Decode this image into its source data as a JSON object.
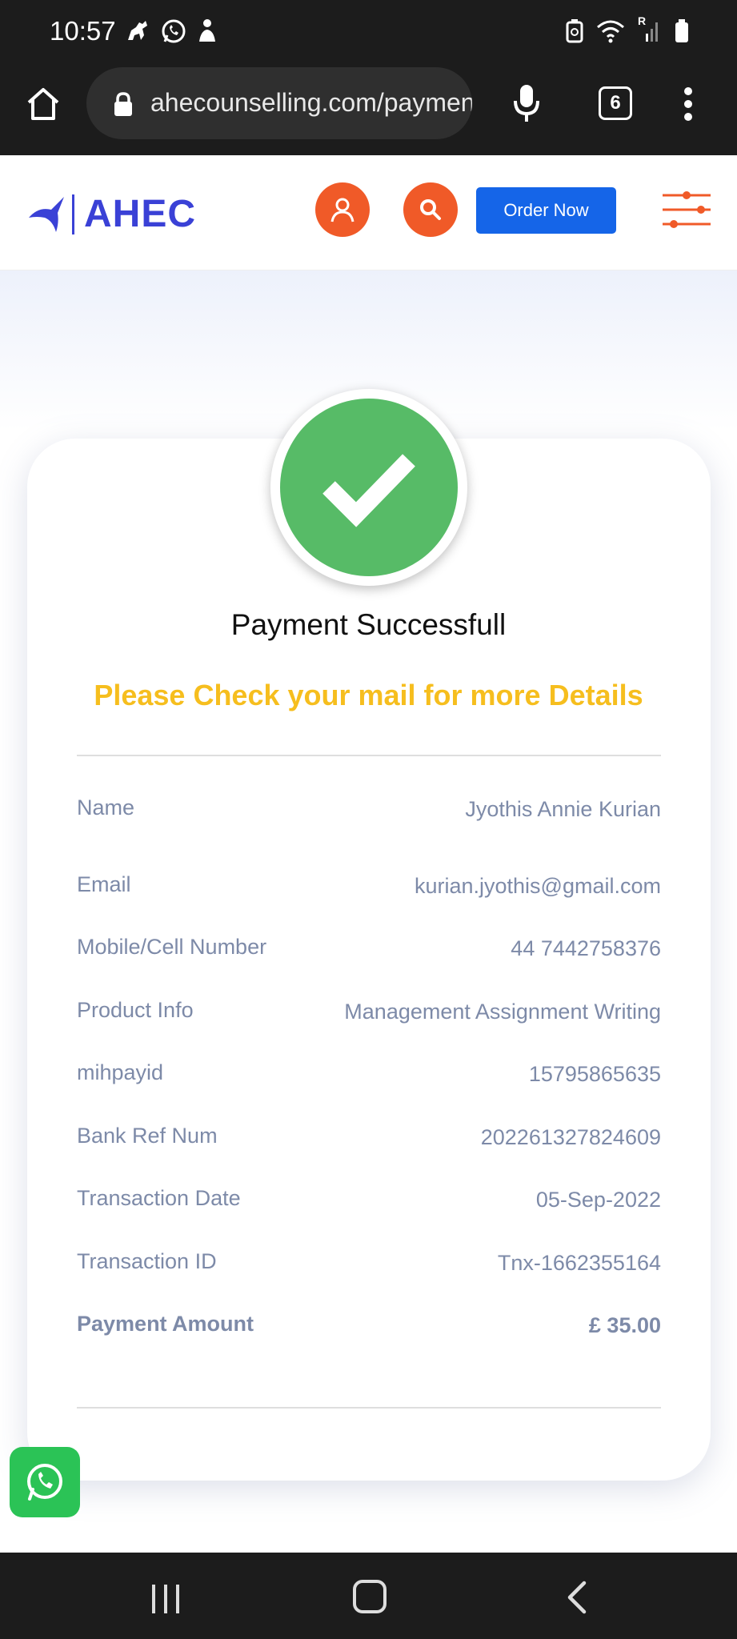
{
  "status_bar": {
    "time": "10:57",
    "icons_left": [
      "horse-icon",
      "whatsapp-icon",
      "person-icon"
    ],
    "icons_right": [
      "recycle-battery-icon",
      "wifi-icon",
      "signal-icon",
      "battery-icon"
    ],
    "signal_label": "R"
  },
  "browser": {
    "url": "ahecounselling.com/payment",
    "tab_count": "6"
  },
  "header": {
    "logo_text": "AHEC",
    "order_button": "Order Now",
    "brand_color": "#3a41d6",
    "accent_color": "#f05a28",
    "button_color": "#1565e8"
  },
  "payment": {
    "title": "Payment Successfull",
    "subtitle": "Please Check your mail for more Details",
    "success_color": "#57bb67",
    "rows": [
      {
        "label": "Name",
        "value": "Jyothis Annie Kurian"
      },
      {
        "label": "Email",
        "value": "kurian.jyothis@gmail.com"
      },
      {
        "label": "Mobile/Cell Number",
        "value": "44 7442758376"
      },
      {
        "label": "Product Info",
        "value": "Management Assignment Writing"
      },
      {
        "label": "mihpayid",
        "value": "15795865635"
      },
      {
        "label": "Bank Ref Num",
        "value": "202261327824609"
      },
      {
        "label": "Transaction Date",
        "value": "05-Sep-2022"
      },
      {
        "label": "Transaction ID",
        "value": "Tnx-1662355164"
      },
      {
        "label": "Payment Amount",
        "value": "£ 35.00"
      }
    ]
  }
}
